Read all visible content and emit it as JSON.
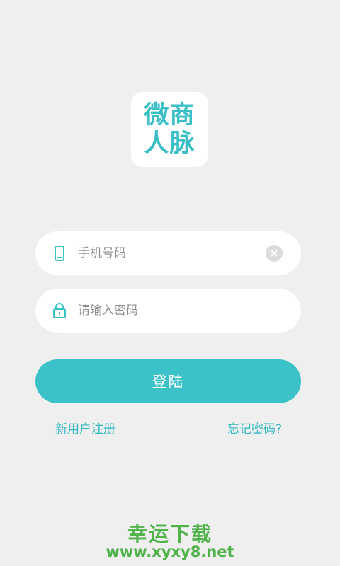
{
  "logo": {
    "line1": "微商",
    "line2": "人脉"
  },
  "phone_field": {
    "placeholder": "手机号码",
    "value": ""
  },
  "password_field": {
    "placeholder": "请输入密码",
    "value": ""
  },
  "login_button": {
    "label": "登陆"
  },
  "links": {
    "register": "新用户注册",
    "forgot_password": "忘记密码?"
  },
  "watermark": {
    "title": "幸运下载",
    "url": "www.xyxy8.net"
  },
  "colors": {
    "background": "#efefef",
    "accent": "#3bc2c8",
    "watermark": "#4fb34a"
  },
  "icons": {
    "phone": "phone-icon",
    "lock": "lock-icon",
    "clear": "clear-icon"
  }
}
